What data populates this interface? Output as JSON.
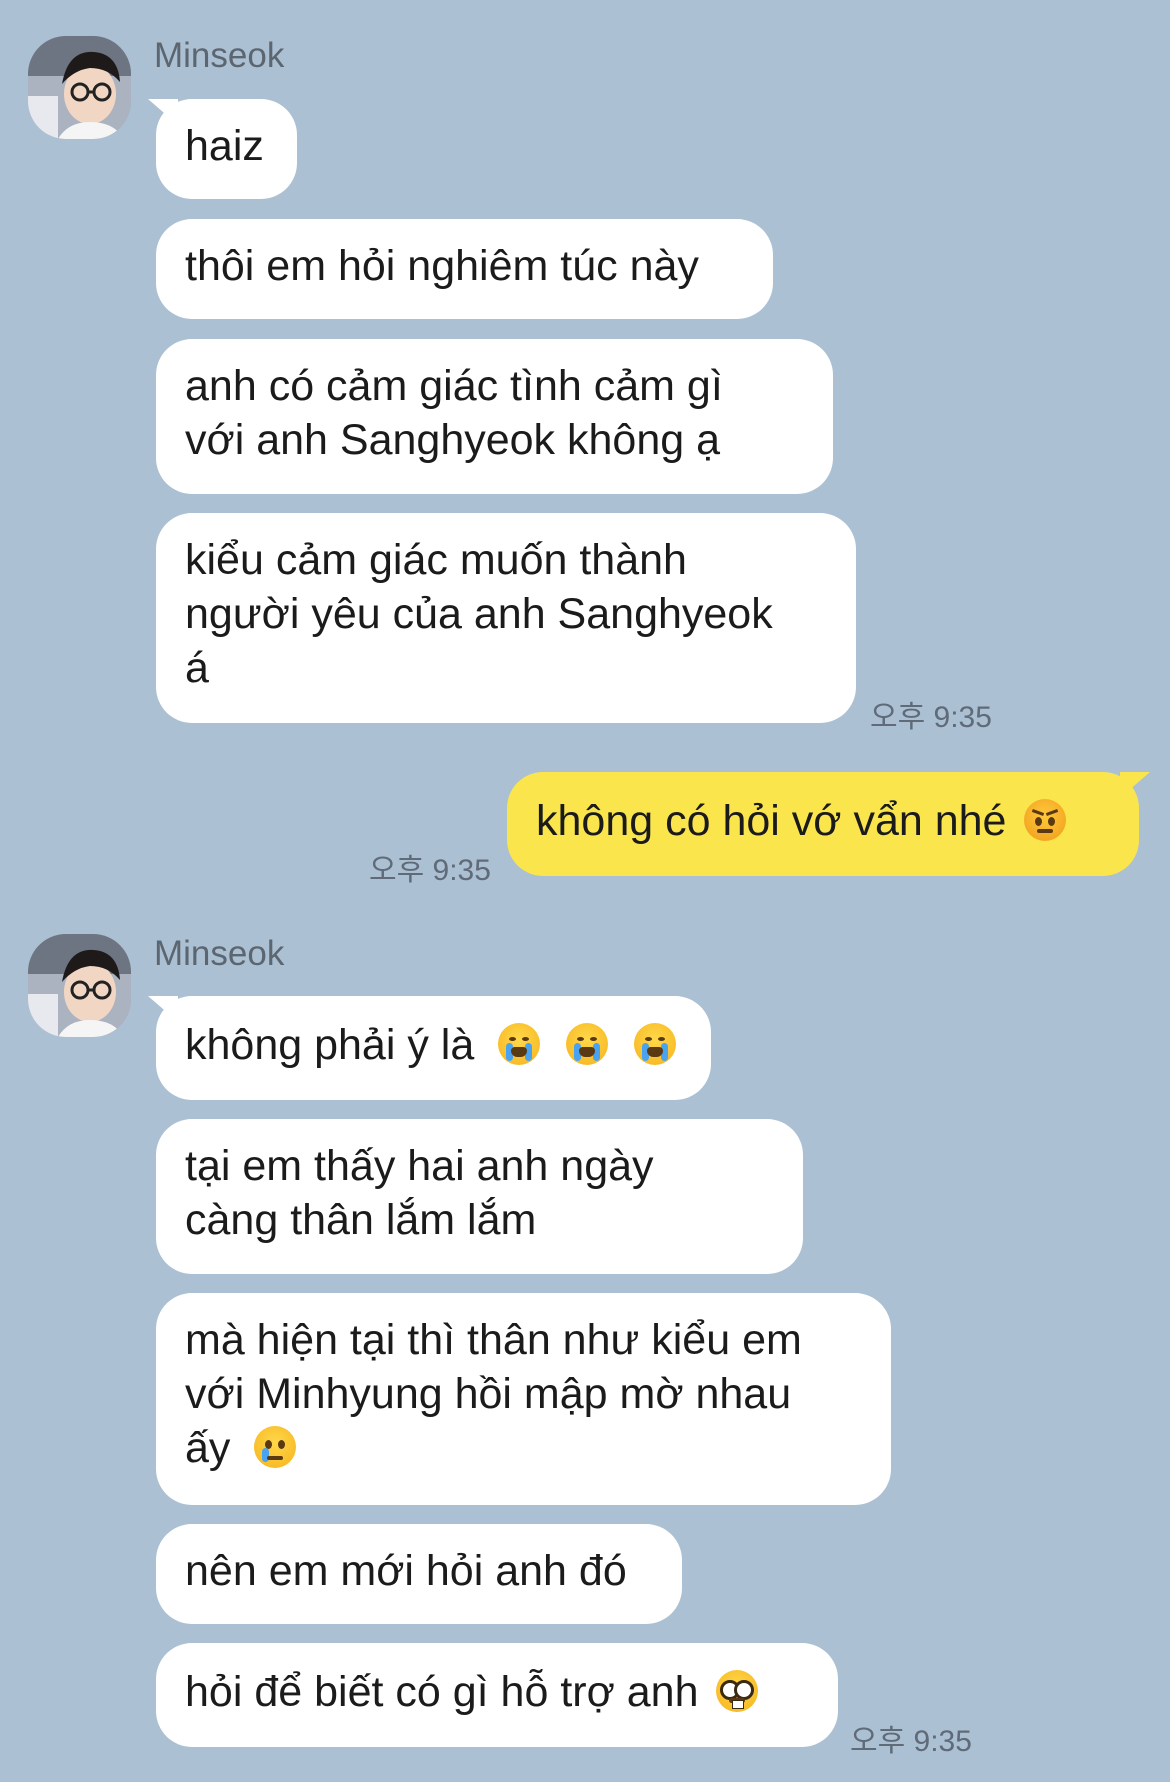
{
  "groups": [
    {
      "sender": "Minseok",
      "messages": [
        {
          "lines": [
            "haiz"
          ]
        },
        {
          "lines": [
            "thôi em hỏi nghiêm túc này"
          ]
        },
        {
          "lines": [
            "anh có cảm giác tình cảm gì",
            "với anh Sanghyeok không ạ"
          ]
        },
        {
          "lines": [
            "kiểu cảm giác muốn thành",
            "người yêu của anh Sanghyeok",
            "á"
          ]
        }
      ],
      "time": "오후 9:35"
    },
    {
      "mine": true,
      "messages": [
        {
          "lines": [
            "không có hỏi vớ vẩn nhé"
          ],
          "emoji": "angry-face-emoji"
        }
      ],
      "time": "오후 9:35"
    },
    {
      "sender": "Minseok",
      "messages": [
        {
          "lines": [
            "không phải ý là"
          ],
          "emoji": "loudly-crying-face-emoji x3"
        },
        {
          "lines": [
            "tại em thấy hai anh ngày",
            "càng thân lắm lắm"
          ]
        },
        {
          "lines": [
            "mà hiện tại thì thân như kiểu em",
            "với Minhyung hồi mập mờ nhau",
            "ấy"
          ],
          "emoji": "crying-face-emoji"
        },
        {
          "lines": [
            "nên em mới hỏi anh đó"
          ]
        },
        {
          "lines": [
            "hỏi để biết có gì hỗ trợ anh"
          ],
          "emoji": "nerd-face-emoji"
        }
      ],
      "time": "오후 9:35"
    }
  ],
  "colors": {
    "background": "#acc0d3",
    "incoming_bubble": "#ffffff",
    "outgoing_bubble": "#fae54d"
  }
}
